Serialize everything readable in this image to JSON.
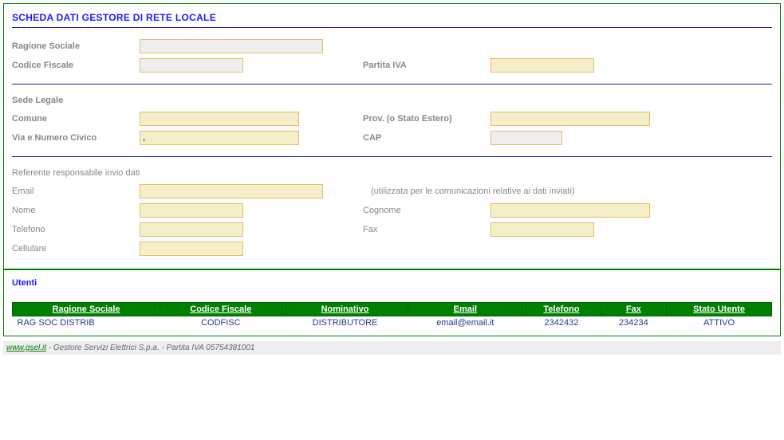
{
  "title": "SCHEDA DATI GESTORE DI RETE LOCALE",
  "labels": {
    "ragione_sociale": "Ragione Sociale",
    "codice_fiscale": "Codice Fiscale",
    "partita_iva": "Partita IVA",
    "sede_legale": "Sede Legale",
    "comune": "Comune",
    "prov": "Prov. (o Stato Estero)",
    "via": "Via e Numero Civico",
    "cap": "CAP",
    "referente": "Referente responsabile invio dati",
    "email": "Email",
    "email_note": "(utilizzata per le comunicazioni relative ai dati inviati)",
    "nome": "Nome",
    "cognome": "Cognome",
    "telefono": "Telefono",
    "fax": "Fax",
    "cellulare": "Cellulare"
  },
  "values": {
    "ragione_sociale": "",
    "codice_fiscale": "",
    "partita_iva": "",
    "comune": "",
    "prov": "",
    "via": ",",
    "cap": "",
    "email": "",
    "nome": "",
    "cognome": "",
    "telefono": "",
    "fax": "",
    "cellulare": ""
  },
  "users": {
    "title": "Utenti",
    "headers": [
      "Ragione Sociale",
      "Codice Fiscale",
      "Nominativo",
      "Email",
      "Telefono",
      "Fax",
      "Stato Utente"
    ],
    "rows": [
      [
        "RAG SOC DISTRIB",
        "CODFISC",
        "DISTRIBUTORE",
        "email@email.it",
        "2342432",
        "234234",
        "ATTIVO"
      ]
    ]
  },
  "footer": {
    "link": "www.gsel.it",
    "text": "  - Gestore Servizi Elettrici S.p.a. - Partita IVA 05754381001"
  }
}
